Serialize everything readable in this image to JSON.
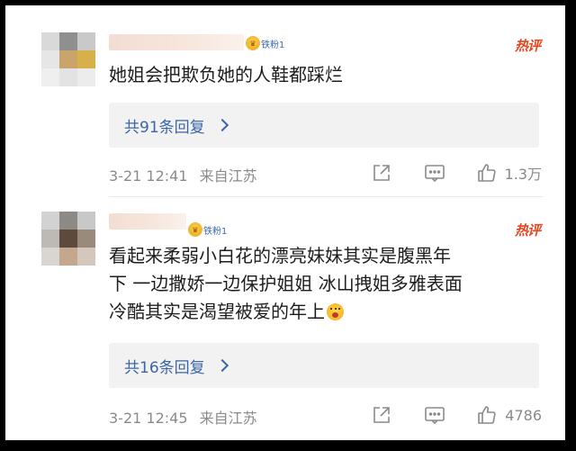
{
  "comments": [
    {
      "badge": "铁粉1",
      "hot_label": "热评",
      "text": "她姐会把欺负她的人鞋都踩烂",
      "replies_label": "共91条回复",
      "time": "3-21 12:41",
      "location": "来自江苏",
      "likes": "1.3万"
    },
    {
      "badge": "铁粉1",
      "hot_label": "热评",
      "text_lines": [
        "看起来柔弱小白花的漂亮妹妹其实是腹黑年",
        "下 一边撒娇一边保护姐姐 冰山拽姐多雅表面",
        "冷酷其实是渴望被爱的年上"
      ],
      "emoji": "tongue-out-emoji",
      "replies_label": "共16条回复",
      "time": "3-21 12:45",
      "location": "来自江苏",
      "likes": "4786"
    }
  ],
  "colors": {
    "link_blue": "#3b66a6",
    "hot_red": "#e8451f",
    "meta_gray": "#8a8a8a"
  }
}
